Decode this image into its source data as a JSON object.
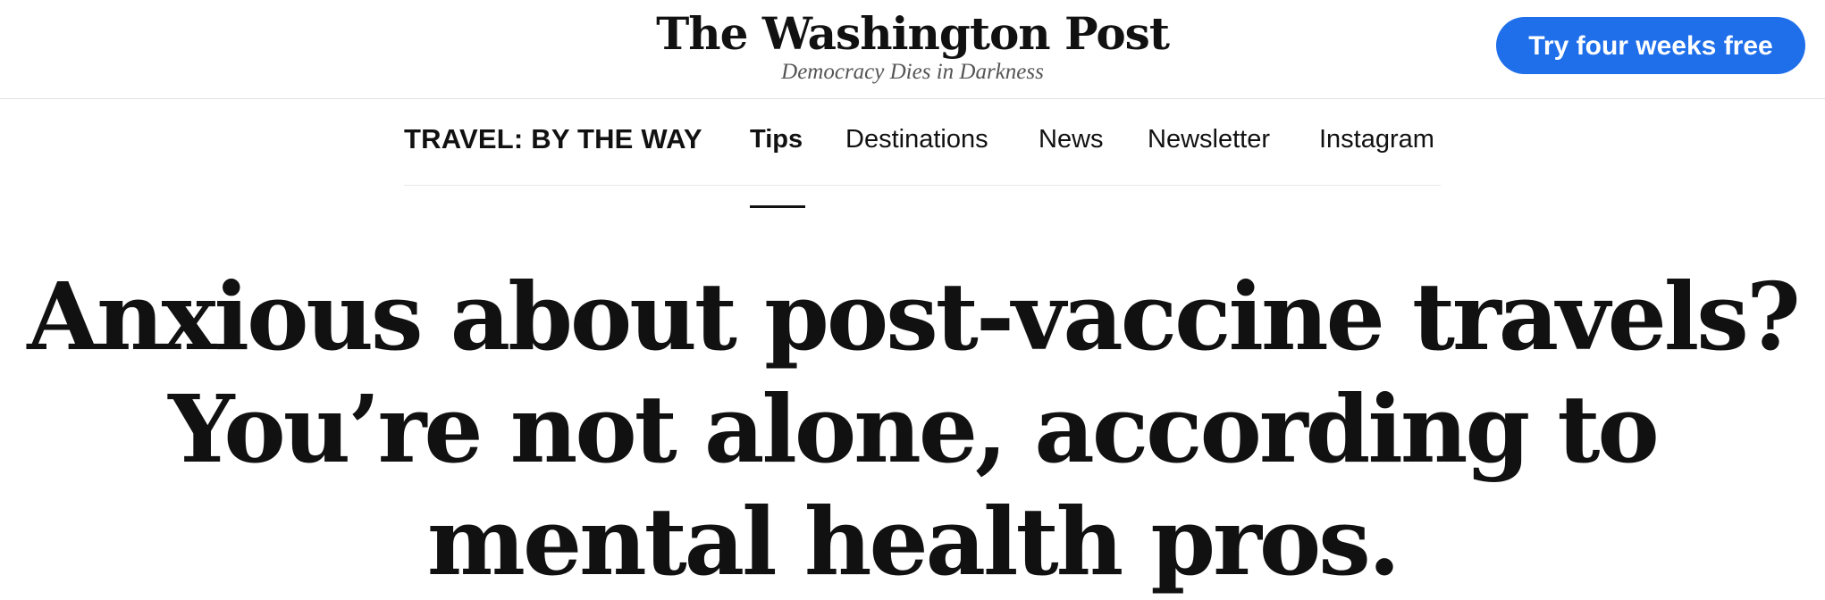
{
  "masthead": {
    "logo_text": "The Washington Post",
    "tagline": "Democracy Dies in Darkness",
    "cta_label": "Try four weeks free",
    "cta_color": "#1f6feb"
  },
  "section_nav": {
    "title": "TRAVEL: BY THE WAY",
    "items": [
      {
        "label": "Tips",
        "active": true
      },
      {
        "label": "Destinations",
        "active": false
      },
      {
        "label": "News",
        "active": false
      },
      {
        "label": "Newsletter",
        "active": false
      },
      {
        "label": "Instagram",
        "active": false
      }
    ]
  },
  "article": {
    "headline": "Anxious about post-vaccine travels? You’re not alone, according to mental health pros."
  }
}
